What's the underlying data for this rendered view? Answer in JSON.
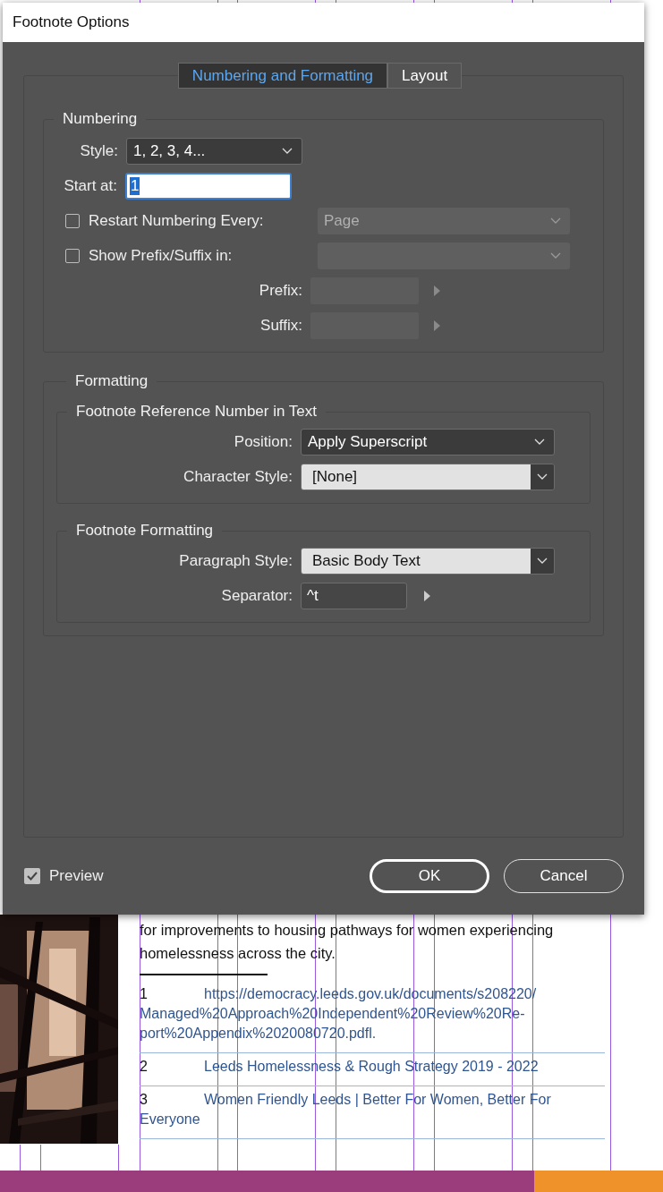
{
  "window": {
    "title": "Footnote Options"
  },
  "tabs": [
    {
      "label": "Numbering and Formatting",
      "selected": true
    },
    {
      "label": "Layout",
      "selected": false
    }
  ],
  "numbering": {
    "title": "Numbering",
    "style": {
      "label": "Style:",
      "value": "1, 2, 3, 4..."
    },
    "start_at": {
      "label": "Start at:",
      "value": "1"
    },
    "restart": {
      "label": "Restart Numbering Every:",
      "checked": false,
      "value": "Page",
      "disabled": true
    },
    "show_prefix_suffix": {
      "label": "Show Prefix/Suffix in:",
      "checked": false,
      "disabled": true
    },
    "prefix": {
      "label": "Prefix:",
      "disabled": true
    },
    "suffix": {
      "label": "Suffix:",
      "disabled": true
    }
  },
  "formatting": {
    "title": "Formatting",
    "reference": {
      "title": "Footnote Reference Number in Text",
      "fields": [
        {
          "label": "Position:",
          "value": "Apply Superscript",
          "kind": "select"
        },
        {
          "label": "Character Style:",
          "value": "[None]",
          "kind": "combo"
        }
      ]
    },
    "footnote_formatting": {
      "title": "Footnote Formatting",
      "fields": [
        {
          "label": "Paragraph Style:",
          "value": "Basic Body Text",
          "kind": "combo"
        },
        {
          "label": "Separator:",
          "value": "^t",
          "kind": "text"
        }
      ]
    }
  },
  "preview": {
    "label": "Preview",
    "checked": true
  },
  "buttons": [
    {
      "label": "OK",
      "kind": "default"
    },
    {
      "label": "Cancel",
      "kind": "normal"
    }
  ],
  "document": {
    "paragraph_lines": [
      "for improvements to housing pathways for women experiencing",
      "homelessness across the city."
    ],
    "footnotes": [
      {
        "number": "1",
        "lines": [
          "https://democracy.leeds.gov.uk/documents/s208220/",
          "Managed%20Approach%20Independent%20Review%20Re-",
          "port%20Appendix%2020080720.pdfl."
        ]
      },
      {
        "number": "2",
        "lines": [
          "Leeds Homelessness & Rough Strategy 2019 - 2022"
        ]
      },
      {
        "number": "3",
        "lines": [
          "Women Friendly Leeds | Better For Women, Better For",
          "Everyone"
        ]
      }
    ]
  }
}
